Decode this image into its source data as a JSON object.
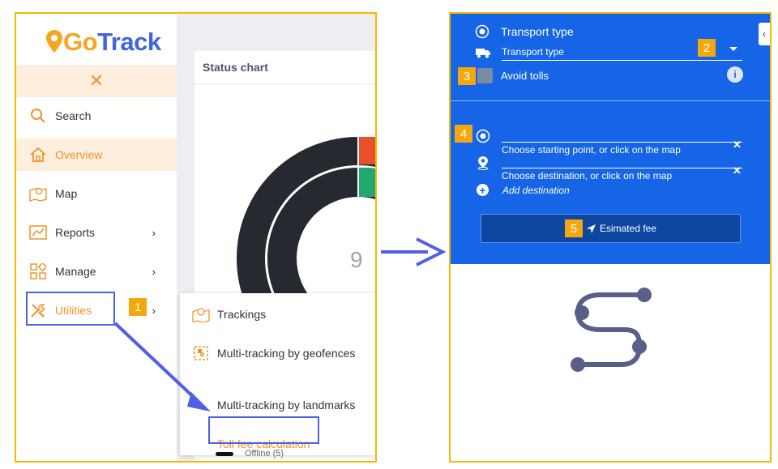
{
  "sidebar": {
    "logo": {
      "part1": "Go",
      "part2": "Track"
    },
    "items": [
      {
        "label": "Search"
      },
      {
        "label": "Overview"
      },
      {
        "label": "Map"
      },
      {
        "label": "Reports"
      },
      {
        "label": "Manage"
      },
      {
        "label": "Utilities"
      }
    ]
  },
  "status_chart": {
    "title": "Status chart",
    "center_value": "9",
    "legend": {
      "offline": "Offline (5)"
    }
  },
  "utilities_menu": {
    "items": [
      {
        "label": "Trackings"
      },
      {
        "label": "Multi-tracking by geofences"
      },
      {
        "label": "Multi-tracking by landmarks"
      },
      {
        "label": "Toll fee calculation"
      }
    ]
  },
  "toll_panel": {
    "transport_type_title": "Transport type",
    "transport_type_value": "Transport type",
    "avoid_tolls_label": "Avoid tolls",
    "starting_point_placeholder": "Choose starting point, or click on the map",
    "destination_placeholder": "Choose destination, or click on the map",
    "add_destination": "Add destination",
    "estimate_button": "Esimated fee"
  },
  "badges": [
    "1",
    "2",
    "3",
    "4",
    "5"
  ],
  "colors": {
    "accent_orange": "#f0932b",
    "brand_blue": "#3f66e0",
    "panel_blue": "#1565e6",
    "highlight_border": "#4f5fe8",
    "badge_bg": "#f5a80c",
    "donut_dark": "#262a30",
    "donut_red": "#e8502b",
    "donut_green": "#22a86e",
    "route_icon": "#5a5f8a"
  }
}
